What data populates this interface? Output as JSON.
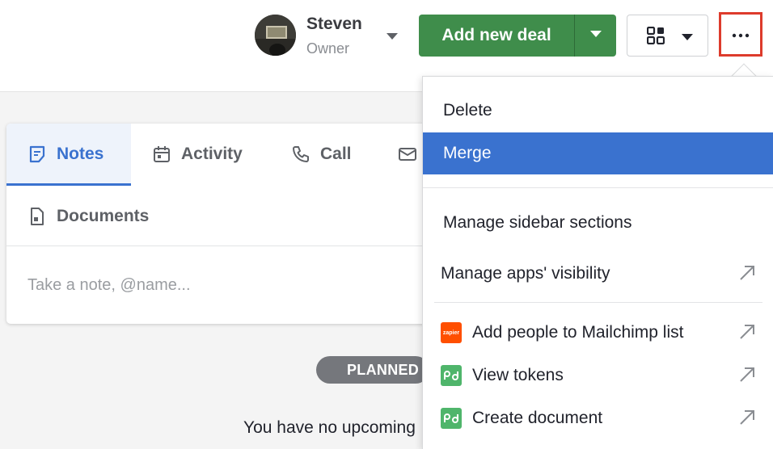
{
  "user": {
    "name": "Steven",
    "role": "Owner"
  },
  "toolbar": {
    "add_deal_label": "Add new deal",
    "more_label": "..."
  },
  "tabs": [
    {
      "label": "Notes",
      "icon": "note-icon",
      "active": true
    },
    {
      "label": "Activity",
      "icon": "calendar-icon",
      "active": false
    },
    {
      "label": "Call",
      "icon": "phone-icon",
      "active": false
    },
    {
      "label": "",
      "icon": "email-icon",
      "active": false
    },
    {
      "label": "Documents",
      "icon": "document-icon",
      "active": false
    }
  ],
  "note": {
    "placeholder": "Take a note, @name..."
  },
  "timeline": {
    "planned_label": "PLANNED",
    "empty_text": "You have no upcoming"
  },
  "menu": {
    "items": [
      {
        "label": "Delete"
      },
      {
        "label": "Merge",
        "highlighted": true
      },
      {
        "label": "Manage sidebar sections"
      },
      {
        "label": "Manage apps' visibility",
        "icon": "external-link-icon"
      },
      {
        "label": "Add people to Mailchimp list",
        "app_icon": "zapier-icon",
        "app_icon_text": "zapier",
        "icon": "external-link-icon"
      },
      {
        "label": "View tokens",
        "app_icon": "pandadoc-icon",
        "icon": "external-link-icon"
      },
      {
        "label": "Create document",
        "app_icon": "pandadoc-icon",
        "icon": "external-link-icon"
      }
    ]
  },
  "colors": {
    "brand_green": "#3f8d4b",
    "accent_blue": "#3a72cf",
    "highlight_red": "#dd3b2c",
    "zapier_orange": "#ff4f00",
    "pandadoc_green": "#4fb56b"
  }
}
